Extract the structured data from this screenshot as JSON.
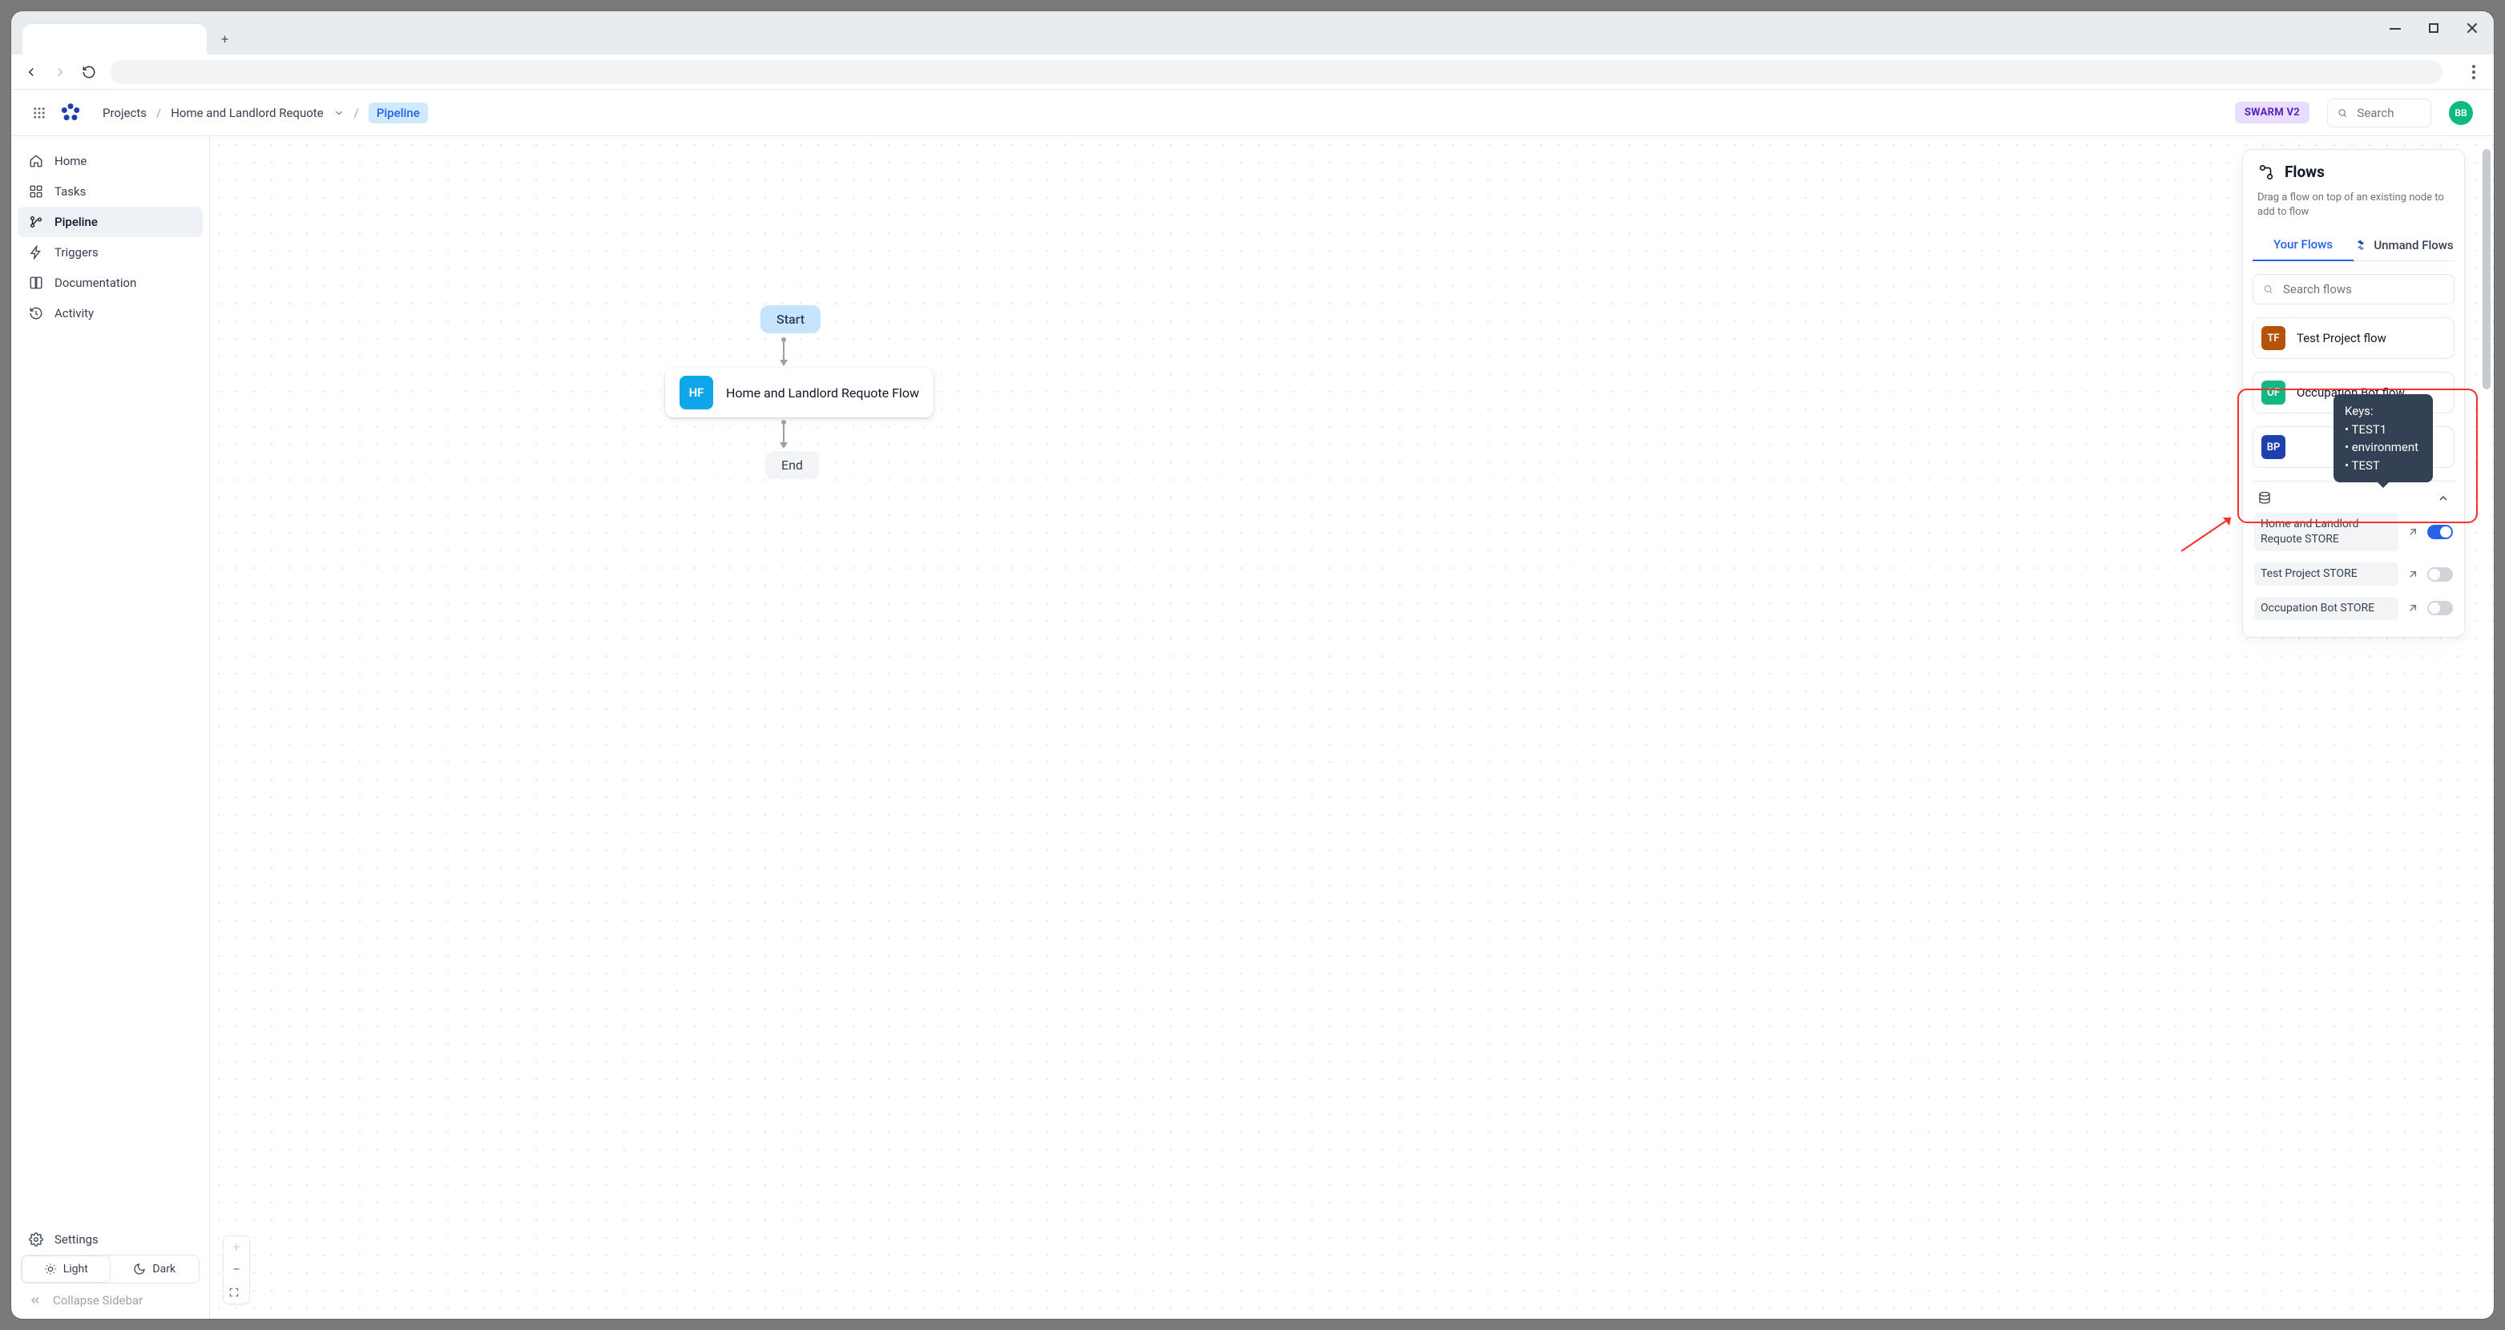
{
  "browser": {
    "new_tab_glyph": "+"
  },
  "header": {
    "breadcrumb": {
      "root": "Projects",
      "project": "Home and Landlord Requote",
      "leaf": "Pipeline"
    },
    "badge": "SWARM V2",
    "search_placeholder": "Search",
    "avatar": "BB"
  },
  "sidebar": {
    "items": [
      {
        "key": "home",
        "label": "Home"
      },
      {
        "key": "tasks",
        "label": "Tasks"
      },
      {
        "key": "pipeline",
        "label": "Pipeline",
        "active": true
      },
      {
        "key": "triggers",
        "label": "Triggers"
      },
      {
        "key": "documentation",
        "label": "Documentation"
      },
      {
        "key": "activity",
        "label": "Activity"
      }
    ],
    "settings": "Settings",
    "theme_light": "Light",
    "theme_dark": "Dark",
    "collapse": "Collapse Sidebar"
  },
  "pipeline": {
    "start": "Start",
    "end": "End",
    "main_node": {
      "initials": "HF",
      "label": "Home and Landlord Requote Flow"
    }
  },
  "flows_panel": {
    "title": "Flows",
    "subtitle": "Drag a flow on top of an existing node to add to flow",
    "tabs": {
      "your": "Your Flows",
      "unmand": "Unmand Flows"
    },
    "search_placeholder": "Search flows",
    "items": [
      {
        "initials": "TF",
        "label": "Test Project flow",
        "color": "brown"
      },
      {
        "initials": "OF",
        "label": "Occupation Bot flow",
        "color": "green"
      },
      {
        "initials": "BP",
        "label": "",
        "color": "navy"
      }
    ],
    "tooltip": {
      "heading": "Keys:",
      "keys": [
        "TEST1",
        "environment",
        "TEST"
      ]
    },
    "stores": [
      {
        "name": "Home and Landlord Requote STORE",
        "on": true
      },
      {
        "name": "Test Project STORE",
        "on": false
      },
      {
        "name": "Occupation Bot STORE",
        "on": false
      }
    ]
  }
}
